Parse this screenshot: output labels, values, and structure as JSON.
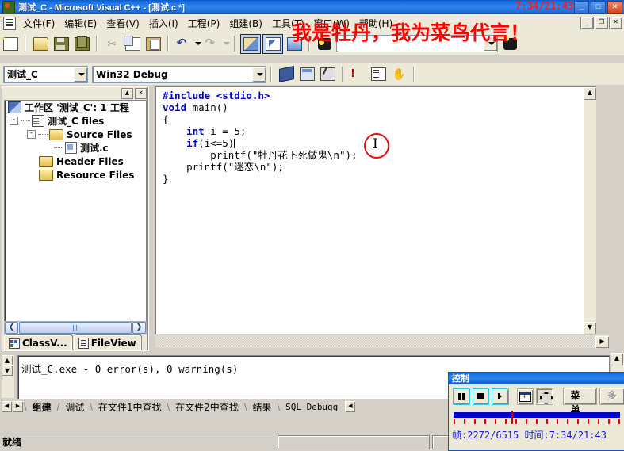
{
  "window": {
    "title": "测试_C - Microsoft Visual C++ - [测试.c *]",
    "time_overlay": "7:34/21:43",
    "minimize_label": "_",
    "maximize_label": "□",
    "close_label": "✕"
  },
  "overlay": {
    "watermark": "我是牡丹，我为菜鸟代言！"
  },
  "menu": {
    "items": [
      {
        "label": "文件(F)"
      },
      {
        "label": "编辑(E)"
      },
      {
        "label": "查看(V)"
      },
      {
        "label": "插入(I)"
      },
      {
        "label": "工程(P)"
      },
      {
        "label": "组建(B)"
      },
      {
        "label": "工具(T)"
      },
      {
        "label": "窗口(W)"
      },
      {
        "label": "帮助(H)"
      }
    ],
    "mdi_buttons": [
      {
        "label": "_",
        "name": "mdi-minimize"
      },
      {
        "label": "❐",
        "name": "mdi-restore"
      },
      {
        "label": "✕",
        "name": "mdi-close"
      }
    ]
  },
  "toolbar_standard": {
    "find_placeholder": "",
    "find_value": "",
    "icons": [
      {
        "name": "new-document-icon"
      },
      {
        "name": "open-folder-icon"
      },
      {
        "name": "save-icon"
      },
      {
        "name": "save-all-icon"
      },
      {
        "name": "cut-icon"
      },
      {
        "name": "copy-icon"
      },
      {
        "name": "paste-icon"
      },
      {
        "name": "undo-icon"
      },
      {
        "name": "redo-icon"
      },
      {
        "name": "workspace-icon"
      },
      {
        "name": "output-window-icon"
      },
      {
        "name": "window-list-icon"
      },
      {
        "name": "find-in-files-icon"
      },
      {
        "name": "find-next-icon"
      }
    ]
  },
  "toolbar_build": {
    "project_combo_value": "测试_C",
    "config_combo_value": "Win32 Debug",
    "icons": [
      {
        "name": "compile-icon"
      },
      {
        "name": "build-icon"
      },
      {
        "name": "execute-icon"
      },
      {
        "name": "stop-build-icon"
      },
      {
        "name": "go-icon"
      },
      {
        "name": "insert-breakpoint-icon"
      }
    ]
  },
  "workspace": {
    "panel_buttons": [
      {
        "label": "▲",
        "name": "workspace-collapse-button"
      },
      {
        "label": "✕",
        "name": "workspace-close-button"
      }
    ],
    "tree": [
      {
        "label": "工作区 '测试_C': 1 工程",
        "icon": "workspace-icon",
        "level": 0,
        "expander": ""
      },
      {
        "label": "测试_C files",
        "icon": "project-icon",
        "level": 1,
        "expander": "-"
      },
      {
        "label": "Source Files",
        "icon": "folder-icon",
        "level": 2,
        "expander": "-"
      },
      {
        "label": "测试.c",
        "icon": "c-file-icon",
        "level": 3,
        "expander": ""
      },
      {
        "label": "Header Files",
        "icon": "folder-icon",
        "level": 2,
        "expander": ""
      },
      {
        "label": "Resource Files",
        "icon": "folder-icon",
        "level": 2,
        "expander": ""
      }
    ],
    "tabs": [
      {
        "label": "ClassV...",
        "icon": "class-view-icon",
        "active": false
      },
      {
        "label": "FileView",
        "icon": "file-view-icon",
        "active": true
      }
    ],
    "hscroll": {
      "left_label": "❮",
      "right_label": "❯"
    }
  },
  "editor": {
    "lines": [
      [
        {
          "t": "#include ",
          "c": "pp"
        },
        {
          "t": "<stdio.h>",
          "c": "pp"
        }
      ],
      [
        {
          "t": "void",
          "c": "kw"
        },
        {
          "t": " main()",
          "c": "pl"
        }
      ],
      [
        {
          "t": "{",
          "c": "pl"
        }
      ],
      [
        {
          "t": "    ",
          "c": "pl"
        },
        {
          "t": "int",
          "c": "kw"
        },
        {
          "t": " i = 5;",
          "c": "pl"
        }
      ],
      [
        {
          "t": "    ",
          "c": "pl"
        },
        {
          "t": "if",
          "c": "kw"
        },
        {
          "t": "(i<=5)",
          "c": "pl"
        }
      ],
      [
        {
          "t": "        printf(\"牡丹花下死做鬼\\n\");",
          "c": "pl"
        }
      ],
      [
        {
          "t": "    printf(\"迷恋\\n\");",
          "c": "pl"
        }
      ],
      [
        {
          "t": "}",
          "c": "pl"
        }
      ]
    ],
    "scroll_up_label": "▲",
    "scroll_down_label": "▼",
    "hscroll_right_label": "▶",
    "cursor_annotation": "I"
  },
  "output": {
    "text": "测试_C.exe - 0 error(s), 0 warning(s)",
    "tabs": [
      {
        "label": "组建",
        "active": true
      },
      {
        "label": "调试",
        "active": false
      },
      {
        "label": "在文件1中查找",
        "active": false
      },
      {
        "label": "在文件2中查找",
        "active": false
      },
      {
        "label": "结果",
        "active": false
      },
      {
        "label": "SQL Debugg",
        "active": false
      }
    ],
    "nav_prev": "◀",
    "nav_next": "▶",
    "scroll_right": "◀",
    "scroll_up_label": "▲",
    "scroll_down_label": "▼"
  },
  "statusbar": {
    "text": "就绪"
  },
  "control_window": {
    "title": "控制",
    "buttons": [
      {
        "name": "pause-button",
        "glyph": "pause"
      },
      {
        "name": "stop-button",
        "glyph": "stop"
      },
      {
        "name": "fast-forward-button",
        "glyph": "ff"
      },
      {
        "name": "move-window-button",
        "glyph": "move"
      },
      {
        "name": "fullscreen-button",
        "glyph": "full"
      }
    ],
    "menu_label": "菜单",
    "more_label": "多",
    "status": "帧:2272/6515 时间:7:34/21:43",
    "frame_current": 2272,
    "frame_total": 6515,
    "time_current": "7:34",
    "time_total": "21:43",
    "progress_percent": 34.9
  },
  "colors": {
    "titlebar_blue": "#2f84ec",
    "accent_red": "#ff0000",
    "keyword_blue": "#0000c0",
    "slider_blue": "#0000cc",
    "tick_red": "#ee0000",
    "chrome": "#ece9d8"
  }
}
